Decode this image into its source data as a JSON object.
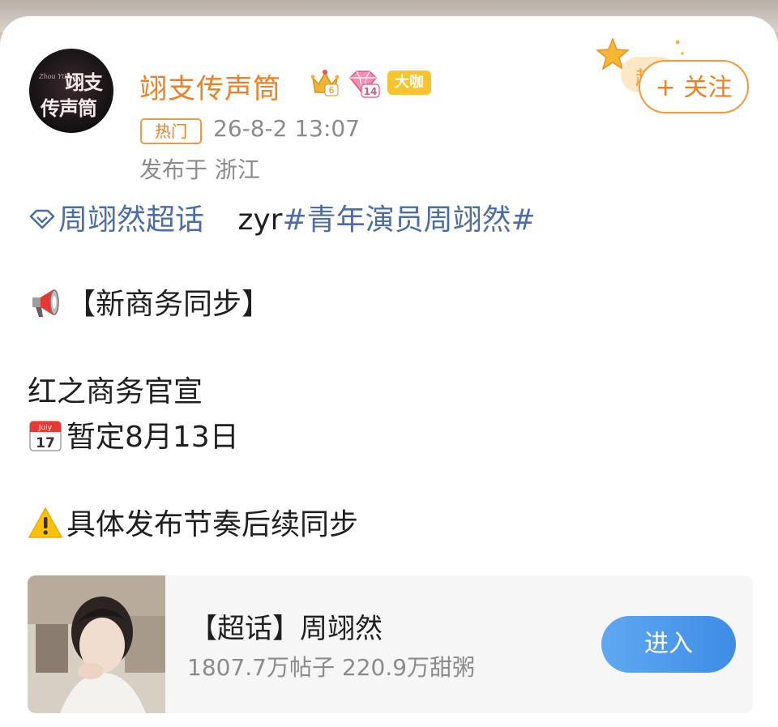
{
  "author": {
    "name": "翊支传声筒",
    "avatar_text_line1": "翊支",
    "avatar_text_line2": "传声筒",
    "avatar_small_text": "Zhou YiRan",
    "crown_level": "6",
    "diamond_level": "14",
    "badge_label": "大咖"
  },
  "meta": {
    "hot_tag": "热门",
    "timestamp": "26-8-2 13:07",
    "location": "发布于 浙江"
  },
  "follow_button": {
    "label": "+ 关注",
    "star_text": "超"
  },
  "post": {
    "topic_link": "周翊然超话",
    "prefix_text": "zyr",
    "hashtag": "#青年演员周翊然#",
    "heading": "【新商务同步】",
    "line1": "红之商务官宣",
    "line2": "暂定8月13日",
    "calendar_month": "July",
    "calendar_day": "17",
    "line3": "具体发布节奏后续同步"
  },
  "supertopic_card": {
    "title": "【超话】周翊然",
    "stats": "1807.7万帖子 220.9万甜粥",
    "enter_label": "进入"
  },
  "colors": {
    "accent_orange": "#f07f22",
    "link_blue": "#4d6da3",
    "enter_blue": "#4a97ec",
    "badge_gold": "#f7c32e"
  }
}
